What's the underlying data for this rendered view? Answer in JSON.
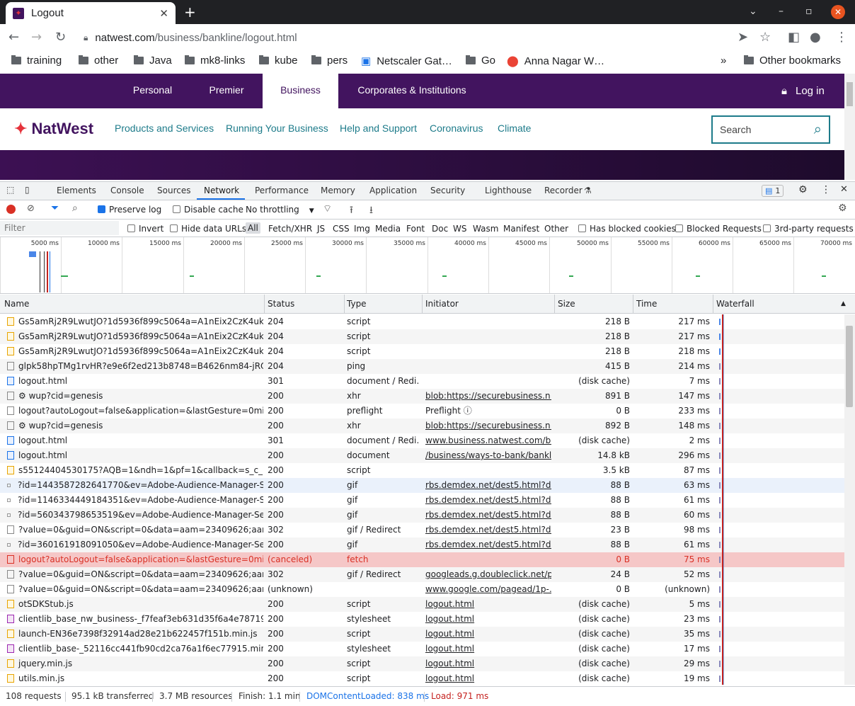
{
  "browser": {
    "tab_title": "Logout",
    "url_host": "natwest.com",
    "url_path": "/business/bankline/logout.html",
    "bookmarks": [
      "training",
      "other",
      "Java",
      "mk8-links",
      "kube",
      "pers",
      "Netscaler Gat…",
      "Go",
      "Anna Nagar W…"
    ],
    "other_bookmarks": "Other bookmarks"
  },
  "site": {
    "top_tabs": [
      "Personal",
      "Premier",
      "Business",
      "Corporates & Institutions"
    ],
    "login": "Log in",
    "logo": "NatWest",
    "nav": [
      "Products and Services",
      "Running Your Business",
      "Help and Support",
      "Coronavirus",
      "Climate"
    ],
    "search_placeholder": "Search"
  },
  "devtools": {
    "tabs": [
      "Elements",
      "Console",
      "Sources",
      "Network",
      "Performance",
      "Memory",
      "Application",
      "Security",
      "Lighthouse",
      "Recorder"
    ],
    "message_count": "1",
    "preserve_log": "Preserve log",
    "disable_cache": "Disable cache",
    "throttling": "No throttling",
    "filter_placeholder": "Filter",
    "invert": "Invert",
    "hide_data_urls": "Hide data URLs",
    "type_filters": [
      "All",
      "Fetch/XHR",
      "JS",
      "CSS",
      "Img",
      "Media",
      "Font",
      "Doc",
      "WS",
      "Wasm",
      "Manifest",
      "Other"
    ],
    "has_blocked_cookies": "Has blocked cookies",
    "blocked_requests": "Blocked Requests",
    "third_party": "3rd-party requests",
    "timeline_ticks": [
      "5000 ms",
      "10000 ms",
      "15000 ms",
      "20000 ms",
      "25000 ms",
      "30000 ms",
      "35000 ms",
      "40000 ms",
      "45000 ms",
      "50000 ms",
      "55000 ms",
      "60000 ms",
      "65000 ms",
      "70000 ms"
    ],
    "columns": [
      "Name",
      "Status",
      "Type",
      "Initiator",
      "Size",
      "Time",
      "Waterfall"
    ],
    "rows": [
      {
        "name": "Gs5amRj2R9LwutJO?1d5936f899c5064a=A1nEix2CzK4uk2J7…",
        "status": "204",
        "type": "script",
        "initiator": "",
        "size": "218 B",
        "time": "217 ms",
        "icon": "script"
      },
      {
        "name": "Gs5amRj2R9LwutJO?1d5936f899c5064a=A1nEix2CzK4uk2J7…",
        "status": "204",
        "type": "script",
        "initiator": "",
        "size": "218 B",
        "time": "217 ms",
        "icon": "script"
      },
      {
        "name": "Gs5amRj2R9LwutJO?1d5936f899c5064a=A1nEix2CzK4uk2J7…",
        "status": "204",
        "type": "script",
        "initiator": "",
        "size": "218 B",
        "time": "218 ms",
        "icon": "script"
      },
      {
        "name": "glpk58hpTMg1rvHR?e9e6f2ed213b8748=B4626nm84-jRQO…",
        "status": "204",
        "type": "ping",
        "initiator": "",
        "size": "415 B",
        "time": "214 ms",
        "icon": "plain"
      },
      {
        "name": "logout.html",
        "status": "301",
        "type": "document / Redi…",
        "initiator": "",
        "size": "(disk cache)",
        "time": "7 ms",
        "icon": "doc"
      },
      {
        "name": "⚙ wup?cid=genesis",
        "status": "200",
        "type": "xhr",
        "initiator": "blob:https://securebusiness.n…",
        "size": "891 B",
        "time": "147 ms",
        "icon": "plain"
      },
      {
        "name": "logout?autoLogout=false&application=&lastGesture=0mins1…",
        "status": "200",
        "type": "preflight",
        "initiator": "Preflight ⓘ",
        "size": "0 B",
        "time": "233 ms",
        "icon": "plain"
      },
      {
        "name": "⚙ wup?cid=genesis",
        "status": "200",
        "type": "xhr",
        "initiator": "blob:https://securebusiness.n…",
        "size": "892 B",
        "time": "148 ms",
        "icon": "plain"
      },
      {
        "name": "logout.html",
        "status": "301",
        "type": "document / Redi…",
        "initiator": "www.business.natwest.com/b…",
        "size": "(disk cache)",
        "time": "2 ms",
        "icon": "doc"
      },
      {
        "name": "logout.html",
        "status": "200",
        "type": "document",
        "initiator": "/business/ways-to-bank/bankli…",
        "size": "14.8 kB",
        "time": "296 ms",
        "icon": "doc"
      },
      {
        "name": "s55124404530175?AQB=1&ndh=1&pf=1&callback=s_c_il[1….",
        "status": "200",
        "type": "script",
        "initiator": "",
        "size": "3.5 kB",
        "time": "87 ms",
        "icon": "script"
      },
      {
        "name": "?id=1443587282641770&ev=Adobe-Audience-Manager-Seg…",
        "status": "200",
        "type": "gif",
        "initiator": "rbs.demdex.net/dest5.html?d…",
        "size": "88 B",
        "time": "63 ms",
        "icon": "small"
      },
      {
        "name": "?id=1146334449184351&ev=Adobe-Audience-Manager-Seg…",
        "status": "200",
        "type": "gif",
        "initiator": "rbs.demdex.net/dest5.html?d…",
        "size": "88 B",
        "time": "61 ms",
        "icon": "small"
      },
      {
        "name": "?id=560343798653519&ev=Adobe-Audience-Manager-Segm…",
        "status": "200",
        "type": "gif",
        "initiator": "rbs.demdex.net/dest5.html?d…",
        "size": "88 B",
        "time": "60 ms",
        "icon": "small"
      },
      {
        "name": "?value=0&guid=ON&script=0&data=aam=23409626;aam=23…",
        "status": "302",
        "type": "gif / Redirect",
        "initiator": "rbs.demdex.net/dest5.html?d…",
        "size": "23 B",
        "time": "98 ms",
        "icon": "plain"
      },
      {
        "name": "?id=360161918091050&ev=Adobe-Audience-Manager-Segm…",
        "status": "200",
        "type": "gif",
        "initiator": "rbs.demdex.net/dest5.html?d…",
        "size": "88 B",
        "time": "61 ms",
        "icon": "small"
      },
      {
        "name": "logout?autoLogout=false&application=&lastGesture=0mins1…",
        "status": "(canceled)",
        "type": "fetch",
        "initiator": "",
        "size": "0 B",
        "time": "75 ms",
        "icon": "err"
      },
      {
        "name": "?value=0&guid=ON&script=0&data=aam=23409626;aam=23…",
        "status": "302",
        "type": "gif / Redirect",
        "initiator": "googleads.g.doubleclick.net/p…",
        "size": "24 B",
        "time": "52 ms",
        "icon": "plain"
      },
      {
        "name": "?value=0&guid=ON&script=0&data=aam=23409626;aam=23…",
        "status": "(unknown)",
        "type": "",
        "initiator": "www.google.com/pagead/1p-…",
        "size": "0 B",
        "time": "(unknown)",
        "icon": "plain"
      },
      {
        "name": "otSDKStub.js",
        "status": "200",
        "type": "script",
        "initiator": "logout.html",
        "size": "(disk cache)",
        "time": "5 ms",
        "icon": "script"
      },
      {
        "name": "clientlib_base_nw_business-_f7feaf3eb631d35f6a4e787199…",
        "status": "200",
        "type": "stylesheet",
        "initiator": "logout.html",
        "size": "(disk cache)",
        "time": "23 ms",
        "icon": "css"
      },
      {
        "name": "launch-EN36e7398f32914ad28e21b622457f151b.min.js",
        "status": "200",
        "type": "script",
        "initiator": "logout.html",
        "size": "(disk cache)",
        "time": "35 ms",
        "icon": "script"
      },
      {
        "name": "clientlib_base-_52116cc441fb90cd2ca76a1f6ec77915.min.css",
        "status": "200",
        "type": "stylesheet",
        "initiator": "logout.html",
        "size": "(disk cache)",
        "time": "17 ms",
        "icon": "css"
      },
      {
        "name": "jquery.min.js",
        "status": "200",
        "type": "script",
        "initiator": "logout.html",
        "size": "(disk cache)",
        "time": "29 ms",
        "icon": "script"
      },
      {
        "name": "utils.min.js",
        "status": "200",
        "type": "script",
        "initiator": "logout.html",
        "size": "(disk cache)",
        "time": "19 ms",
        "icon": "script"
      }
    ],
    "status": {
      "requests": "108 requests",
      "transferred": "95.1 kB transferred",
      "resources": "3.7 MB resources",
      "finish": "Finish: 1.1 min",
      "dcl": "DOMContentLoaded: 838 ms",
      "load": "Load: 971 ms",
      "dcl_color": "#1a73e8",
      "load_color": "#c5221f"
    }
  }
}
